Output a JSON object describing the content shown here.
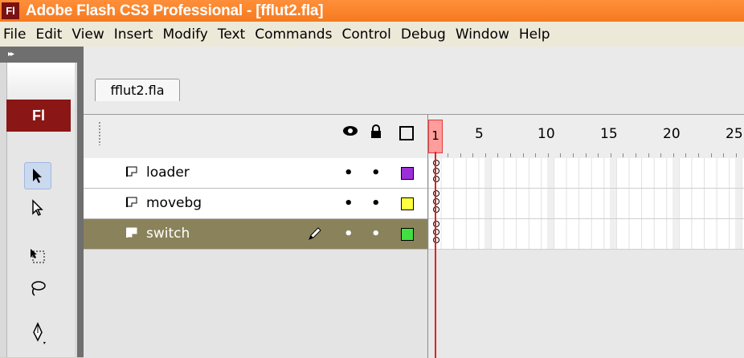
{
  "window": {
    "title": "Adobe Flash CS3 Professional - [fflut2.fla]",
    "icon_text": "Fl"
  },
  "menu": [
    "File",
    "Edit",
    "View",
    "Insert",
    "Modify",
    "Text",
    "Commands",
    "Control",
    "Debug",
    "Window",
    "Help"
  ],
  "tools": {
    "panel_collapse": "▸▸",
    "logo_text": "Fl",
    "items": [
      "selection-tool",
      "subselection-tool",
      "free-transform-tool",
      "lasso-tool",
      "pen-tool"
    ]
  },
  "document": {
    "tab_label": "fflut2.fla"
  },
  "timeline": {
    "header_icons": [
      "eye-icon",
      "lock-icon",
      "outline-icon"
    ],
    "ruler": [
      "1",
      "5",
      "10",
      "15",
      "20",
      "25"
    ],
    "current_frame": "1",
    "layers": [
      {
        "name": "loader",
        "color": "#9b30d9",
        "selected": false
      },
      {
        "name": "movebg",
        "color": "#ffff40",
        "selected": false
      },
      {
        "name": "switch",
        "color": "#40e040",
        "selected": true
      }
    ]
  }
}
